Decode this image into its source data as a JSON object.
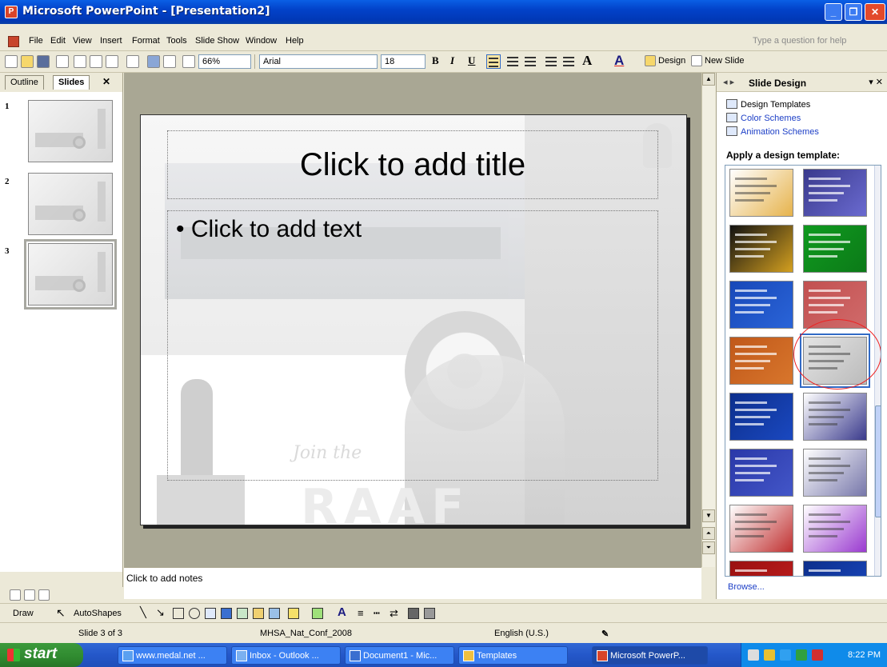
{
  "window": {
    "title": "Microsoft PowerPoint - [Presentation2]"
  },
  "menu": {
    "items": [
      "File",
      "Edit",
      "View",
      "Insert",
      "Format",
      "Tools",
      "Slide Show",
      "Window",
      "Help"
    ],
    "help_placeholder": "Type a question for help"
  },
  "toolbar": {
    "zoom": "66%",
    "font": "Arial",
    "font_size": "18",
    "bold": "B",
    "italic": "I",
    "underline": "U",
    "design_label": "Design",
    "new_slide_label": "New Slide"
  },
  "left_pane": {
    "tabs": [
      "Outline",
      "Slides"
    ],
    "active_tab": "Slides",
    "slides": [
      {
        "number": "1"
      },
      {
        "number": "2"
      },
      {
        "number": "3",
        "selected": true
      }
    ]
  },
  "slide": {
    "title_placeholder": "Click to add title",
    "body_placeholder": "• Click to add text",
    "background_text": {
      "join": "Join the",
      "raaf": "RAAF"
    }
  },
  "notes": {
    "placeholder": "Click to add notes"
  },
  "task_pane": {
    "title": "Slide Design",
    "links": [
      "Design Templates",
      "Color Schemes",
      "Animation Schemes"
    ],
    "apply_heading": "Apply a design template:",
    "browse": "Browse...",
    "templates": [
      {
        "bg": "#ffffff",
        "accent": "#e6b34c",
        "light": true
      },
      {
        "bg": "#3a3a8c",
        "accent": "#6a6ad0",
        "light": false
      },
      {
        "bg": "#111111",
        "accent": "#d4a020",
        "light": false
      },
      {
        "bg": "#0f9a1f",
        "accent": "#0c7a18",
        "light": false
      },
      {
        "bg": "#1848b8",
        "accent": "#2a64d8",
        "light": false
      },
      {
        "bg": "#c25050",
        "accent": "#d06a6a",
        "light": false
      },
      {
        "bg": "#c0581a",
        "accent": "#d8762c",
        "light": false
      },
      {
        "bg": "#e4e4e4",
        "accent": "#bbbbbb",
        "light": true,
        "selected": true
      },
      {
        "bg": "#0d2f8c",
        "accent": "#1a48c0",
        "light": false
      },
      {
        "bg": "#ffffff",
        "accent": "#3a3a8c",
        "light": true
      },
      {
        "bg": "#2a38a8",
        "accent": "#4356c8",
        "light": false
      },
      {
        "bg": "#ffffff",
        "accent": "#7777aa",
        "light": true
      },
      {
        "bg": "#ffffff",
        "accent": "#c03030",
        "light": true
      },
      {
        "bg": "#ffffff",
        "accent": "#9a3ad0",
        "light": true
      },
      {
        "bg": "#9a1010",
        "accent": "#c02020",
        "light": false
      },
      {
        "bg": "#0d2f8c",
        "accent": "#1a48c0",
        "light": false
      }
    ]
  },
  "draw_toolbar": {
    "draw_label": "Draw",
    "autoshapes_label": "AutoShapes"
  },
  "status": {
    "slide_count": "Slide 3 of 3",
    "design_name": "MHSA_Nat_Conf_2008",
    "language": "English (U.S.)"
  },
  "taskbar": {
    "start": "start",
    "tasks": [
      {
        "label": "www.medal.net ...",
        "active": false
      },
      {
        "label": "Inbox - Outlook ...",
        "active": false
      },
      {
        "label": "Document1 - Mic...",
        "active": false
      },
      {
        "label": "Templates",
        "active": false
      },
      {
        "label": "Microsoft PowerP...",
        "active": true
      }
    ],
    "clock": "8:22 PM"
  },
  "colors": {
    "title_bar": "#0242c9",
    "taskbar": "#2457c9",
    "start_button": "#2f8a2f",
    "link": "#1e40c7",
    "highlight_circle": "#e22222"
  }
}
